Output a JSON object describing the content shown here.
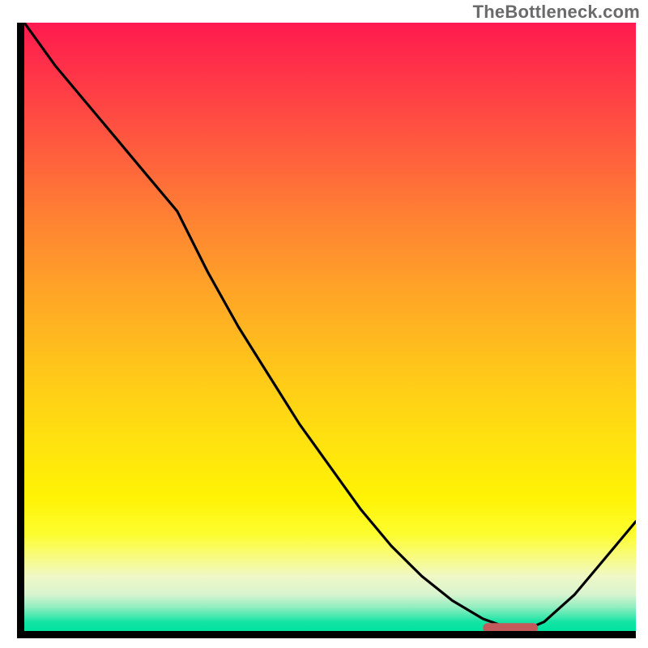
{
  "watermark": "TheBottleneck.com",
  "chart_data": {
    "type": "line",
    "title": "",
    "xlabel": "",
    "ylabel": "",
    "xlim": [
      0,
      100
    ],
    "ylim": [
      0,
      100
    ],
    "grid": false,
    "legend": false,
    "background": "red-yellow-green vertical gradient (red high, green low)",
    "series": [
      {
        "name": "curve",
        "x": [
          0,
          5,
          10,
          15,
          20,
          25,
          30,
          35,
          40,
          45,
          50,
          55,
          60,
          65,
          70,
          75,
          80,
          82,
          85,
          90,
          95,
          100
        ],
        "values": [
          100,
          93,
          87,
          81,
          75,
          69,
          59,
          50,
          42,
          34,
          27,
          20,
          14,
          9,
          5,
          2,
          0.2,
          0.2,
          1.5,
          6,
          12,
          18
        ]
      }
    ],
    "annotation": {
      "shape": "rounded-bar",
      "x_start": 75,
      "x_end": 84,
      "y": 0.5,
      "color": "#c25a5c"
    }
  }
}
